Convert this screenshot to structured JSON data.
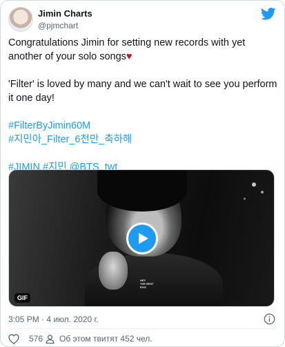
{
  "author": {
    "name": "Jimin Charts",
    "handle": "@pjmchart"
  },
  "tweet": {
    "line1": "Congratulations Jimin for setting new records with yet another of your solo songs",
    "heart_glyph": "♥",
    "line2": "'Filter' is loved by many and we can't wait to see you perform it one day!",
    "hashtag1": "#FilterByJimin60M",
    "hashtag2": "#지민아_Filter_6천만_축하해",
    "tags3a": "#JIMIN",
    "tags3b": "#지민",
    "tags3c": "@BTS_twt"
  },
  "media": {
    "badge": "GIF",
    "shirt_text": "HEY\nTHE BEST\nEGG"
  },
  "meta": {
    "timestamp": "3:05 PM · 4 июл. 2020 г."
  },
  "actions": {
    "likes": "576",
    "talking": "Об этом твитят 452 чел."
  },
  "icons": {
    "brand": "twitter-bird-icon",
    "play": "play-icon",
    "info": "info-icon",
    "like": "heart-icon",
    "talking": "person-icon"
  },
  "colors": {
    "accent": "#1d9bf0",
    "heart": "#c0182b",
    "muted": "#536471"
  }
}
